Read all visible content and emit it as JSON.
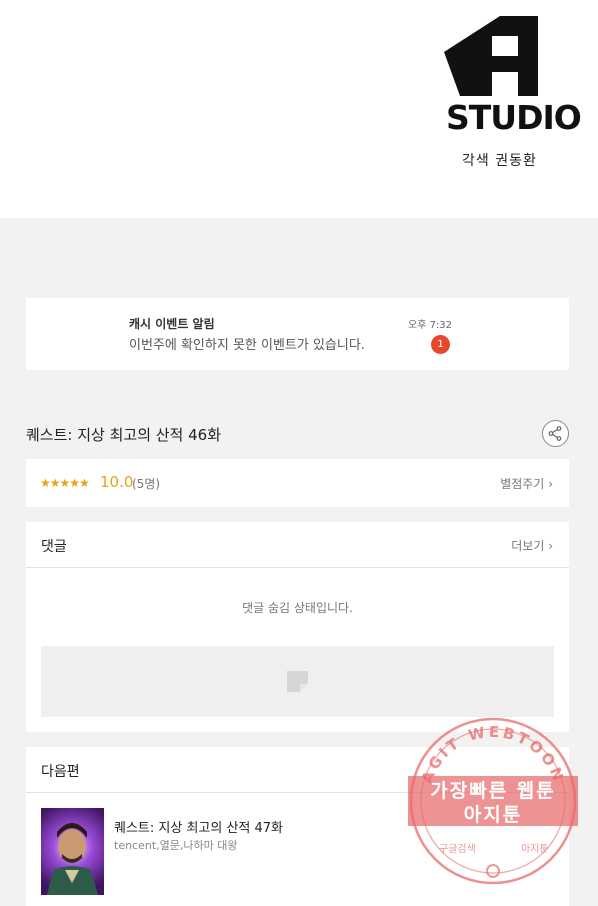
{
  "header": {
    "studio_name": "STUDIO",
    "credit": "각색 권동환"
  },
  "notification": {
    "title": "캐시 이벤트 알림",
    "time": "오후 7:32",
    "message": "이번주에 확인하지 못한 이벤트가 있습니다.",
    "badge_count": "1"
  },
  "episode": {
    "title": "퀘스트: 지상 최고의 산적 46화"
  },
  "rating": {
    "stars": "★★★★★",
    "score": "10.0",
    "voters": "(5명)",
    "rate_label": "별점주기"
  },
  "comments": {
    "title": "댓글",
    "more_label": "더보기",
    "hidden_message": "댓글 숨김 상태입니다."
  },
  "next": {
    "title": "다음편",
    "episode_title": "퀘스트: 지상 최고의 산적 47화",
    "meta": "tencent,열문,나하마 대왕"
  },
  "watermark": {
    "arc_text": "AGIT WEBTOON",
    "line1": "가장빠른 웹툰",
    "line2": "아지툰",
    "bottom_left": "구글검색",
    "bottom_right": "아지툰"
  },
  "colors": {
    "accent_star": "#e8a317",
    "badge": "#e5482d",
    "stamp": "#e86a6a"
  }
}
